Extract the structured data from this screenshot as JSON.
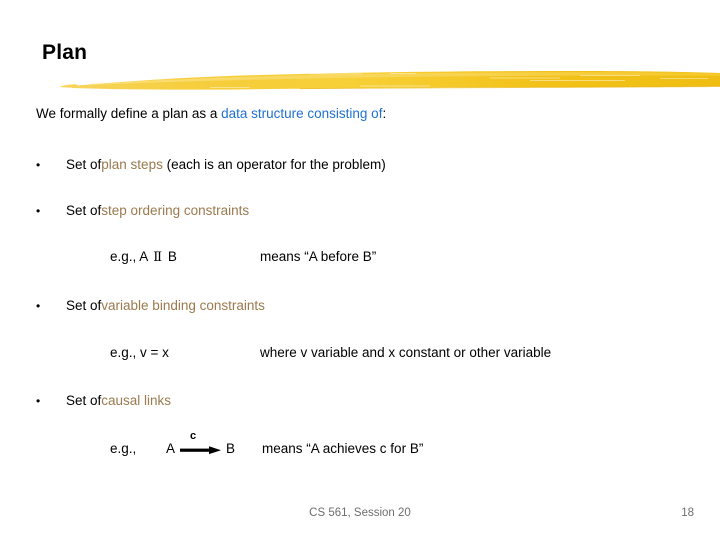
{
  "slide": {
    "title": "Plan",
    "accent_color": "#F5C518",
    "highlight_blue": "#1f6fd0",
    "highlight_gold": "#9a7a4e"
  },
  "intro": {
    "lead": "We formally define a plan as a ",
    "highlight": "data structure consisting of",
    "trail": ":"
  },
  "bullets": [
    {
      "marker": "•",
      "lead": "Set of ",
      "highlight": "plan steps",
      "trail": " (each is an operator for the problem)"
    },
    {
      "marker": "•",
      "lead": "Set of ",
      "highlight": "step ordering constraints",
      "trail": ""
    },
    {
      "marker": "•",
      "lead": "Set of ",
      "highlight": "variable binding constraints",
      "trail": ""
    },
    {
      "marker": "•",
      "lead": "Set of ",
      "highlight": "causal links",
      "trail": ""
    }
  ],
  "examples": [
    {
      "prefix": "e.g., A ",
      "symbol": "Ⅱ",
      "suffix": " B",
      "meaning": "means “A before B”"
    },
    {
      "expr": "e.g., v = x",
      "meaning": "where v variable and x constant or other variable"
    },
    {
      "prefix": "e.g., ",
      "node_a": "A",
      "node_b": "B",
      "link_label": "c",
      "meaning": "means “A achieves c for B”"
    }
  ],
  "footer": {
    "course": "CS 561, Session 20",
    "page_number": "18"
  }
}
